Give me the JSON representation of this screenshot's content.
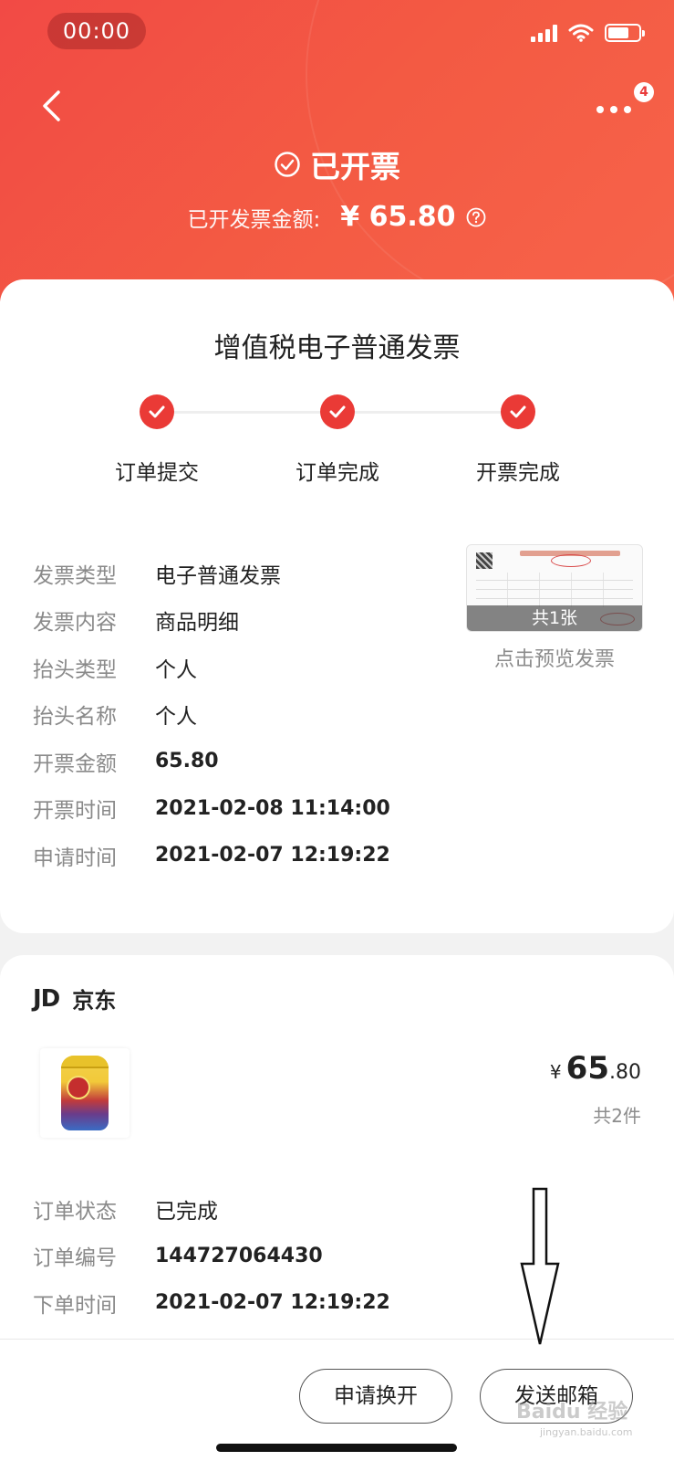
{
  "status_bar": {
    "time": "00:00"
  },
  "header": {
    "more_badge": "4",
    "status_title": "已开票",
    "amount_label": "已开发票金额:",
    "amount_value": "¥ 65.80"
  },
  "invoice": {
    "type_title": "增值税电子普通发票",
    "steps": [
      {
        "label": "订单提交"
      },
      {
        "label": "订单完成"
      },
      {
        "label": "开票完成"
      }
    ],
    "fields": [
      {
        "key": "发票类型",
        "value": "电子普通发票"
      },
      {
        "key": "发票内容",
        "value": "商品明细"
      },
      {
        "key": "抬头类型",
        "value": "个人"
      },
      {
        "key": "抬头名称",
        "value": "个人"
      },
      {
        "key": "开票金额",
        "value": "65.80"
      },
      {
        "key": "开票时间",
        "value": "2021-02-08 11:14:00"
      },
      {
        "key": "申请时间",
        "value": "2021-02-07 12:19:22"
      }
    ],
    "preview": {
      "count_label": "共1张",
      "link_label": "点击预览发票"
    }
  },
  "order": {
    "shop_logo": "JD",
    "shop_name": "京东",
    "price_currency": "¥",
    "price_int": "65",
    "price_dec": ".80",
    "quantity": "共2件",
    "fields": [
      {
        "key": "订单状态",
        "value": "已完成"
      },
      {
        "key": "订单编号",
        "value": "144727064430"
      },
      {
        "key": "下单时间",
        "value": "2021-02-07 12:19:22"
      }
    ]
  },
  "actions": {
    "reissue_label": "申请换开",
    "email_label": "发送邮箱"
  },
  "watermark": {
    "brand": "Baidu 经验",
    "url": "jingyan.baidu.com"
  },
  "colors": {
    "accent": "#ea3a36",
    "header_bg": "#f24a45"
  }
}
